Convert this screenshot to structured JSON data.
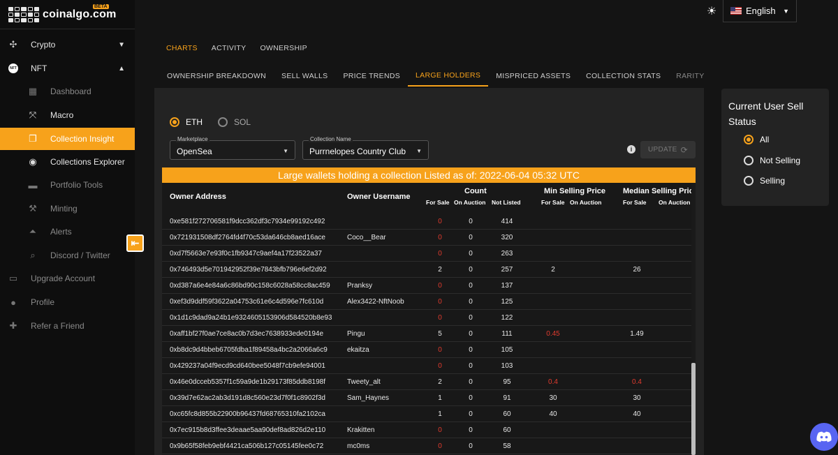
{
  "brand": {
    "name": "coinalgo.com",
    "badge": "BETA"
  },
  "sidebar": {
    "items": [
      {
        "label": "Crypto",
        "icon": "network-icon"
      },
      {
        "label": "NFT",
        "icon": "nft-icon"
      },
      {
        "label": "Dashboard",
        "icon": "dashboard-icon"
      },
      {
        "label": "Macro",
        "icon": "expand-icon"
      },
      {
        "label": "Collection Insight",
        "icon": "collection-icon"
      },
      {
        "label": "Collections Explorer",
        "icon": "compass-icon"
      },
      {
        "label": "Portfolio Tools",
        "icon": "briefcase-icon"
      },
      {
        "label": "Minting",
        "icon": "hammer-icon"
      },
      {
        "label": "Alerts",
        "icon": "alerts-icon"
      },
      {
        "label": "Discord / Twitter",
        "icon": "social-icon"
      },
      {
        "label": "Upgrade Account",
        "icon": "card-icon"
      },
      {
        "label": "Profile",
        "icon": "person-icon"
      },
      {
        "label": "Refer a Friend",
        "icon": "gift-icon"
      }
    ]
  },
  "topbar": {
    "language": "English"
  },
  "tabs_primary": [
    "CHARTS",
    "ACTIVITY",
    "OWNERSHIP"
  ],
  "tabs_secondary": [
    "OWNERSHIP BREAKDOWN",
    "SELL WALLS",
    "PRICE TRENDS",
    "LARGE HOLDERS",
    "MISPRICED ASSETS",
    "COLLECTION STATS",
    "RARITY"
  ],
  "filters": {
    "chain_options": [
      "ETH",
      "SOL"
    ],
    "marketplace_label": "Marketplace",
    "marketplace_value": "OpenSea",
    "collection_label": "Collection Name",
    "collection_value": "Purrnelopes Country Club",
    "update_label": "UPDATE"
  },
  "banner": "Large wallets holding a collection Listed as of: 2022-06-04 05:32 UTC",
  "table": {
    "headers": {
      "owner_address": "Owner Address",
      "owner_username": "Owner Username",
      "count": "Count",
      "min_price": "Min Selling Price",
      "median_price": "Median Selling Price",
      "for_sale": "For Sale",
      "on_auction": "On Auction",
      "not_listed": "Not Listed"
    },
    "rows": [
      {
        "address": "0xe581f272706581f9dcc362df3c7934e99192c492",
        "username": "",
        "for_sale": "0",
        "on_auction": "0",
        "not_listed": "414",
        "min_for_sale": "",
        "median_for_sale": ""
      },
      {
        "address": "0x721931508df2764fd4f70c53da646cb8aed16ace",
        "username": "Coco__Bear",
        "for_sale": "0",
        "on_auction": "0",
        "not_listed": "320",
        "min_for_sale": "",
        "median_for_sale": ""
      },
      {
        "address": "0xd7f5663e7e93f0c1fb9347c9aef4a17f23522a37",
        "username": "",
        "for_sale": "0",
        "on_auction": "0",
        "not_listed": "263",
        "min_for_sale": "",
        "median_for_sale": ""
      },
      {
        "address": "0x746493d5e701942952f39e7843bfb796e6ef2d92",
        "username": "",
        "for_sale": "2",
        "on_auction": "0",
        "not_listed": "257",
        "min_for_sale": "2",
        "median_for_sale": "26"
      },
      {
        "address": "0xd387a6e4e84a6c86bd90c158c6028a58cc8ac459",
        "username": "Pranksy",
        "for_sale": "0",
        "on_auction": "0",
        "not_listed": "137",
        "min_for_sale": "",
        "median_for_sale": ""
      },
      {
        "address": "0xef3d9ddf59f3622a04753c61e6c4d596e7fc610d",
        "username": "Alex3422-NftNoob",
        "for_sale": "0",
        "on_auction": "0",
        "not_listed": "125",
        "min_for_sale": "",
        "median_for_sale": ""
      },
      {
        "address": "0x1d1c9dad9a24b1e9324605153906d584520b8e93",
        "username": "",
        "for_sale": "0",
        "on_auction": "0",
        "not_listed": "122",
        "min_for_sale": "",
        "median_for_sale": ""
      },
      {
        "address": "0xaff1bf27f0ae7ce8ac0b7d3ec7638933ede0194e",
        "username": "Pingu",
        "for_sale": "5",
        "on_auction": "0",
        "not_listed": "111",
        "min_for_sale": "0.45",
        "median_for_sale": "1.49"
      },
      {
        "address": "0xb8dc9d4bbeb6705fdba1f89458a4bc2a2066a6c9",
        "username": "ekaitza",
        "for_sale": "0",
        "on_auction": "0",
        "not_listed": "105",
        "min_for_sale": "",
        "median_for_sale": ""
      },
      {
        "address": "0x429237a04f9ecd9cd640bee5048f7cb9efe94001",
        "username": "",
        "for_sale": "0",
        "on_auction": "0",
        "not_listed": "103",
        "min_for_sale": "",
        "median_for_sale": ""
      },
      {
        "address": "0x46e0dcceb5357f1c59a9de1b29173f85ddb8198f",
        "username": "Tweety_alt",
        "for_sale": "2",
        "on_auction": "0",
        "not_listed": "95",
        "min_for_sale": "0.4",
        "median_for_sale": "0.4"
      },
      {
        "address": "0x39d7e62ac2ab3d191d8c560e23d7f0f1c8902f3d",
        "username": "Sam_Haynes",
        "for_sale": "1",
        "on_auction": "0",
        "not_listed": "91",
        "min_for_sale": "30",
        "median_for_sale": "30"
      },
      {
        "address": "0xc65fc8d855b22900b96437fd68765310fa2102ca",
        "username": "",
        "for_sale": "1",
        "on_auction": "0",
        "not_listed": "60",
        "min_for_sale": "40",
        "median_for_sale": "40"
      },
      {
        "address": "0x7ec915b8d3ffee3deaae5aa90def8ad826d2e110",
        "username": "Krakitten",
        "for_sale": "0",
        "on_auction": "0",
        "not_listed": "60",
        "min_for_sale": "",
        "median_for_sale": ""
      },
      {
        "address": "0x9b65f58feb9ebf4421ca506b127c05145fee0c72",
        "username": "mc0ms",
        "for_sale": "0",
        "on_auction": "0",
        "not_listed": "58",
        "min_for_sale": "",
        "median_for_sale": ""
      }
    ]
  },
  "sell_status": {
    "title": "Current User Sell Status",
    "options": [
      "All",
      "Not Selling",
      "Selling"
    ]
  },
  "colors": {
    "accent": "#f7a21b",
    "negative": "#e23b2e",
    "discord": "#5865f2"
  }
}
